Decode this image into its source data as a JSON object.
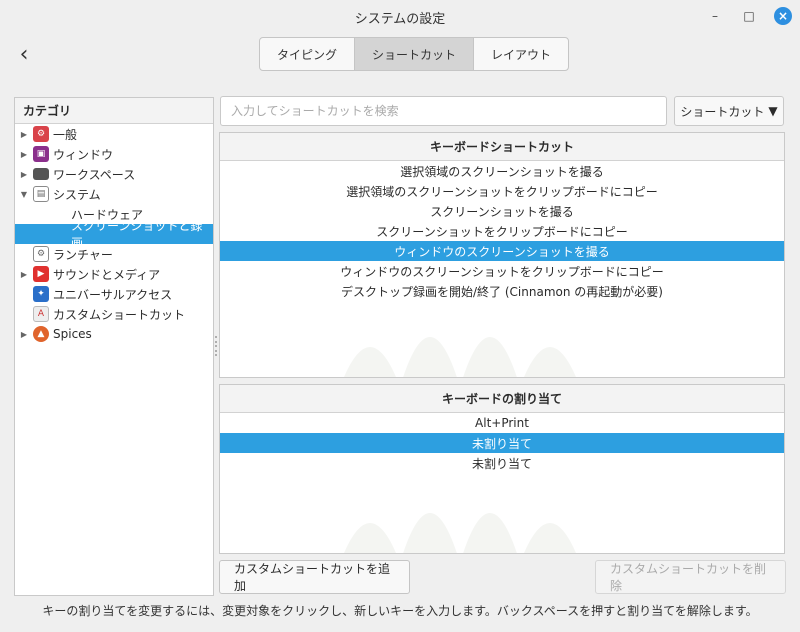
{
  "window": {
    "title": "システムの設定",
    "minimize_glyph": "–",
    "maximize_glyph": "□",
    "close_glyph": "×"
  },
  "nav": {
    "back_glyph": "‹"
  },
  "tabs": [
    {
      "label": "タイピング",
      "active": false
    },
    {
      "label": "ショートカット",
      "active": true
    },
    {
      "label": "レイアウト",
      "active": false
    }
  ],
  "sidebar": {
    "header": "カテゴリ",
    "items": [
      {
        "label": "一般",
        "expander": "collapsed",
        "icon": "general-icon",
        "color": "#d9434a"
      },
      {
        "label": "ウィンドウ",
        "expander": "collapsed",
        "icon": "windows-icon",
        "color": "#8b2f8c"
      },
      {
        "label": "ワークスペース",
        "expander": "collapsed",
        "icon": "workspace-icon",
        "color": "#555555"
      },
      {
        "label": "システム",
        "expander": "expanded",
        "icon": "system-icon",
        "color": "#8a8a8a"
      },
      {
        "label": "ハードウェア",
        "sub": true
      },
      {
        "label": "スクリーンショットと録画",
        "sub": true,
        "selected": true
      },
      {
        "label": "ランチャー",
        "icon": "launcher-icon",
        "color": "#8a8a8a"
      },
      {
        "label": "サウンドとメディア",
        "expander": "collapsed",
        "icon": "sound-icon",
        "color": "#e0312f"
      },
      {
        "label": "ユニバーサルアクセス",
        "icon": "accessibility-icon",
        "color": "#2a6fc9"
      },
      {
        "label": "カスタムショートカット",
        "icon": "custom-shortcut-icon",
        "color": "#d4d4d4"
      },
      {
        "label": "Spices",
        "expander": "collapsed",
        "icon": "spices-icon",
        "color": "#e0642c"
      }
    ]
  },
  "search": {
    "placeholder": "入力してショートカットを検索",
    "value": ""
  },
  "filter_button": {
    "label": "ショートカット",
    "glyph": "▼"
  },
  "shortcuts_panel": {
    "header": "キーボードショートカット",
    "rows": [
      "選択領域のスクリーンショットを撮る",
      "選択領域のスクリーンショットをクリップボードにコピー",
      "スクリーンショットを撮る",
      "スクリーンショットをクリップボードにコピー",
      "ウィンドウのスクリーンショットを撮る",
      "ウィンドウのスクリーンショットをクリップボードにコピー",
      "デスクトップ録画を開始/終了 (Cinnamon の再起動が必要)"
    ],
    "selected_index": 4
  },
  "bindings_panel": {
    "header": "キーボードの割り当て",
    "rows": [
      "Alt+Print",
      "未割り当て",
      "未割り当て"
    ],
    "selected_index": 1
  },
  "buttons": {
    "add": "カスタムショートカットを追加",
    "remove": "カスタムショートカットを削除"
  },
  "status_text": "キーの割り当てを変更するには、変更対象をクリックし、新しいキーを入力します。バックスペースを押すと割り当てを解除します。",
  "colors": {
    "accent": "#2d9fe0",
    "window_bg": "#efefef"
  }
}
